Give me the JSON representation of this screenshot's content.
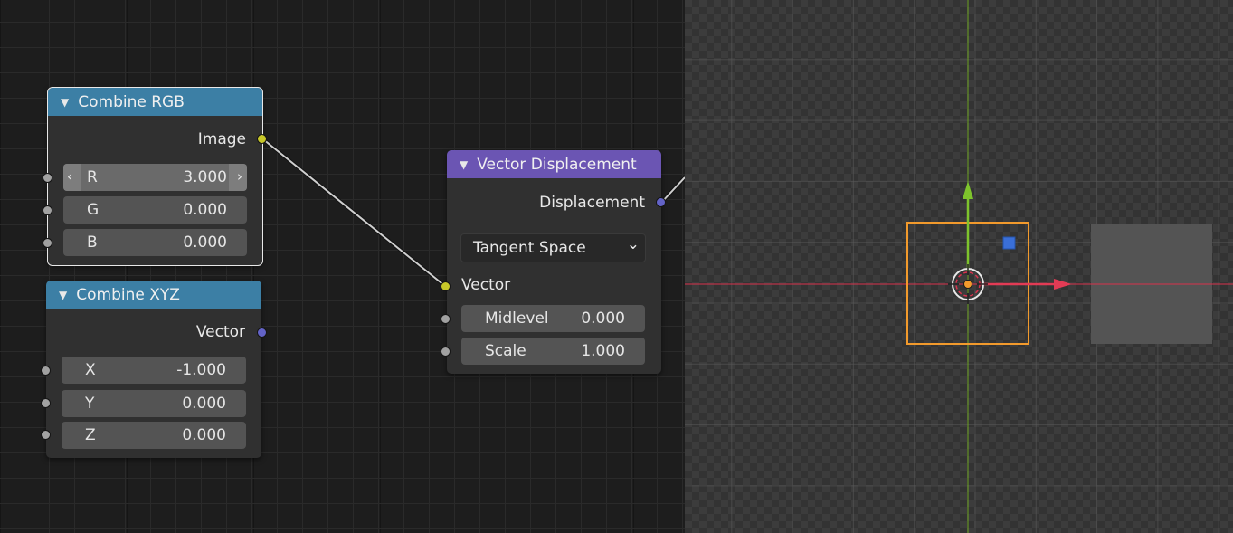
{
  "nodes": {
    "combine_rgb": {
      "title": "Combine RGB",
      "output": "Image",
      "inputs": [
        {
          "label": "R",
          "value": "3.000"
        },
        {
          "label": "G",
          "value": "0.000"
        },
        {
          "label": "B",
          "value": "0.000"
        }
      ]
    },
    "combine_xyz": {
      "title": "Combine XYZ",
      "output": "Vector",
      "inputs": [
        {
          "label": "X",
          "value": "-1.000"
        },
        {
          "label": "Y",
          "value": "0.000"
        },
        {
          "label": "Z",
          "value": "0.000"
        }
      ]
    },
    "vector_displacement": {
      "title": "Vector Displacement",
      "output": "Displacement",
      "space": "Tangent Space",
      "vector_label": "Vector",
      "inputs": [
        {
          "label": "Midlevel",
          "value": "0.000"
        },
        {
          "label": "Scale",
          "value": "1.000"
        }
      ]
    }
  },
  "icons": {
    "collapse": "triangle-down-icon",
    "decrement": "chevron-left-icon",
    "increment": "chevron-right-icon",
    "dropdown": "chevron-down-icon"
  },
  "glyphs": {
    "collapse": "▼",
    "decrement": "‹",
    "increment": "›",
    "dropdown": "⌄"
  },
  "colors": {
    "header_input": "#3c7fa5",
    "header_vector": "#6b55b3",
    "socket_color": "#c7c729",
    "socket_vector": "#6363c7",
    "socket_float": "#a1a1a1",
    "selection": "#f29a2c",
    "axis_x": "#d8324d",
    "axis_y": "#6fa623"
  }
}
